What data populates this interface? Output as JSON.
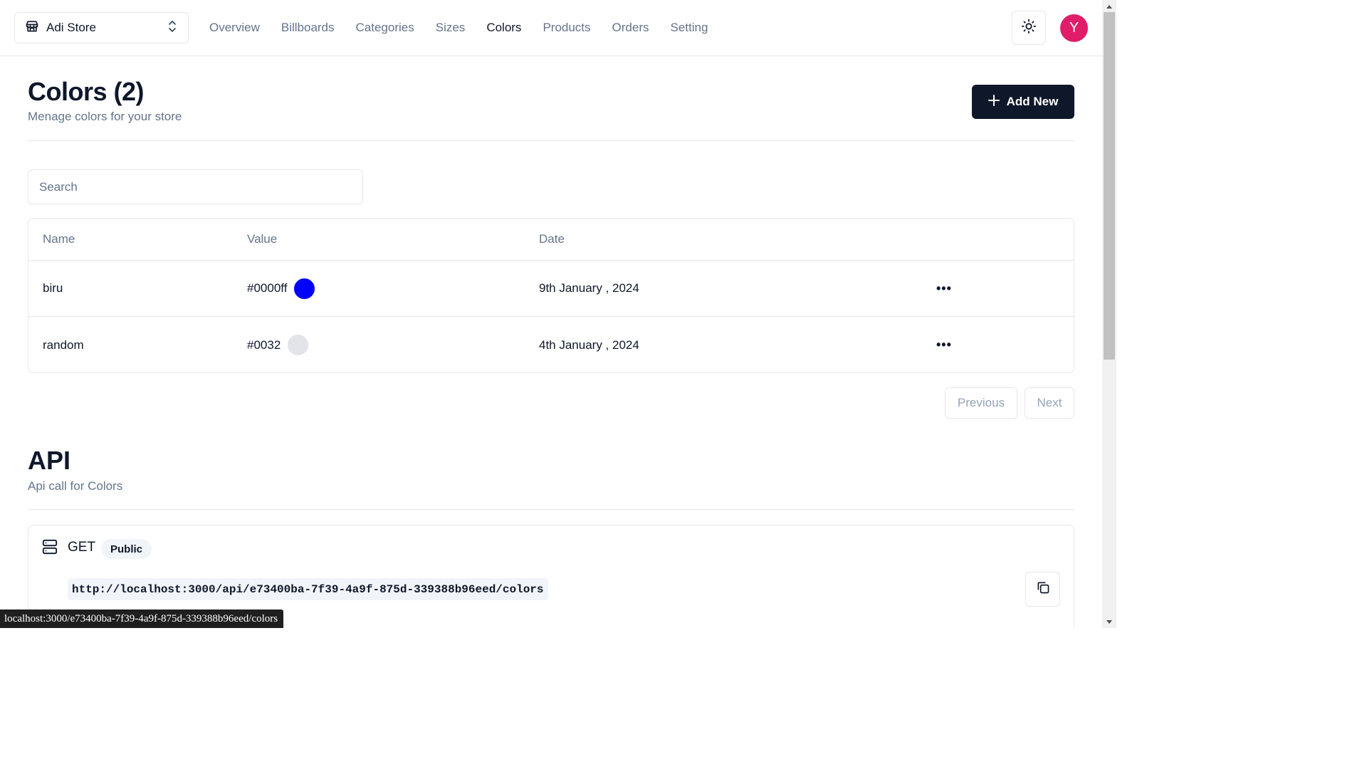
{
  "store": {
    "name": "Adi Store"
  },
  "nav": {
    "items": [
      "Overview",
      "Billboards",
      "Categories",
      "Sizes",
      "Colors",
      "Products",
      "Orders",
      "Setting"
    ],
    "active": "Colors"
  },
  "user": {
    "initial": "Y",
    "avatar_color": "#e11d6a"
  },
  "header": {
    "title": "Colors (2)",
    "subtitle": "Menage colors for your store",
    "add_label": "Add New"
  },
  "search": {
    "placeholder": "Search",
    "value": ""
  },
  "table": {
    "columns": [
      "Name",
      "Value",
      "Date"
    ],
    "rows": [
      {
        "name": "biru",
        "value": "#0000ff",
        "swatch": "#0000ff",
        "date": "9th January , 2024",
        "actions": "•••"
      },
      {
        "name": "random",
        "value": "#0032",
        "swatch": "#e2e4ea",
        "date": "4th January , 2024",
        "actions": "•••"
      }
    ]
  },
  "pagination": {
    "previous": "Previous",
    "next": "Next"
  },
  "api": {
    "title": "API",
    "subtitle": "Api call for Colors",
    "method": "GET",
    "badge": "Public",
    "url": "http://localhost:3000/api/e73400ba-7f39-4a9f-875d-339388b96eed/colors"
  },
  "status_bar": {
    "url": "localhost:3000/e73400ba-7f39-4a9f-875d-339388b96eed/colors"
  },
  "colors": {
    "primary": "#0f172a",
    "muted": "#64748b",
    "border": "#e5e7eb"
  }
}
